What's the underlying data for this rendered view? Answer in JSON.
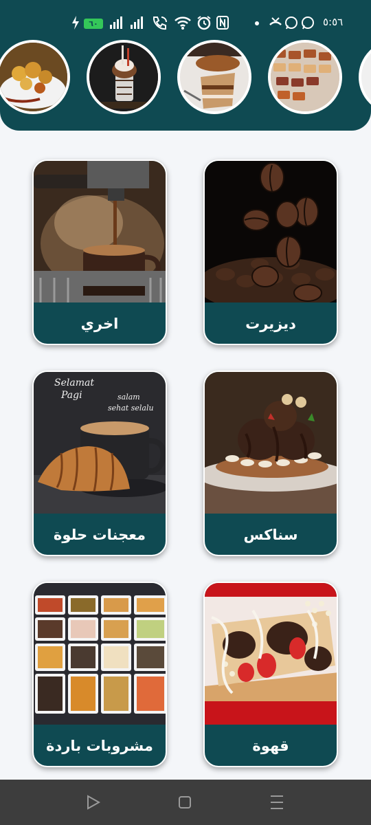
{
  "status_bar": {
    "time": "٥:٥٦",
    "battery": "٦٠",
    "icons": [
      "charging-icon",
      "signal-icon",
      "signal-icon",
      "wifi-call-icon",
      "wifi-icon",
      "alarm-icon",
      "nfc-icon",
      "dot-icon",
      "missed-call-icon",
      "whatsapp-icon",
      "whatsapp-icon"
    ]
  },
  "stories": [
    {
      "name": "story-waffle-fruit"
    },
    {
      "name": "story-milkshake"
    },
    {
      "name": "story-lotus-cake"
    },
    {
      "name": "story-pastry-tray"
    },
    {
      "name": "story-partial"
    }
  ],
  "categories": [
    {
      "label": "ديزيرت",
      "image": "coffee-beans-image"
    },
    {
      "label": "اخري",
      "image": "espresso-machine-image"
    },
    {
      "label": "سناكس",
      "image": "chocolate-waffle-image"
    },
    {
      "label": "معجنات حلوة",
      "image": "croissant-coffee-image"
    },
    {
      "label": "قهوة",
      "image": "strawberry-crepe-image"
    },
    {
      "label": "مشروبات باردة",
      "image": "waffle-tray-image"
    }
  ],
  "croissant_overlay": {
    "line1": "Selamat",
    "line2": "Pagi",
    "line3": "salam",
    "line4": "sehat selalu"
  },
  "nav": {
    "icons": [
      "back-icon",
      "home-icon",
      "menu-icon"
    ]
  },
  "colors": {
    "primary": "#0f4a52",
    "background": "#f4f6f9",
    "navbar": "#3d3d3d"
  }
}
